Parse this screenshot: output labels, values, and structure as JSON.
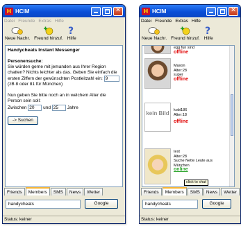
{
  "left_window": {
    "title": "HCIM",
    "menu": [
      "Datei",
      "Freunde",
      "Extras",
      "Hilfe"
    ],
    "toolbar": [
      "Neue Nachr.",
      "Freund hinzuf.",
      "Hilfe"
    ],
    "heading": "Handycheats Instant Messenger",
    "section": "Personensuche:",
    "intro": "Sie würden gerne mit jemanden aus Ihrer Region chatten? Nichts leichter als das. Geben Sie einfach die ersten Ziffern der gewünschten Postleitzahl ein:",
    "zip_value": "9",
    "zip_hint": "(zB 8 oder 81 für München)",
    "age_text": "Nun geben Sie bitte noch an in welchem Alter die Person sein soll:",
    "between": "Zwischen",
    "age_min": "20",
    "and": "und",
    "age_max": "25",
    "years": "Jahre",
    "search_button": "-> Suchen",
    "tabs": [
      "Friends",
      "Members",
      "SMS",
      "News",
      "Wetter"
    ],
    "bottom_input": "handycheats",
    "google_button": "Google",
    "status": "Status: keiner"
  },
  "right_window": {
    "title": "HCIM",
    "menu": [
      "Datei",
      "Freunde",
      "Extras",
      "Hilfe"
    ],
    "toolbar": [
      "Neue Nachr.",
      "Freund hinzuf.",
      "Hilfe"
    ],
    "users": [
      {
        "line1": "egg fun sind",
        "status": "offline"
      },
      {
        "name": "Maxon",
        "age": "Alter:28",
        "desc": "super",
        "status": "offline"
      },
      {
        "name": "kobi186",
        "age": "Alter:18",
        "nopic": "kein Bild",
        "status": "offline"
      },
      {
        "name": "test",
        "age": "Alter:28",
        "desc": "Suche Nette Leute aus München",
        "status": "online"
      }
    ],
    "tooltip": "click to chat",
    "tabs": [
      "Friends",
      "Members",
      "SMS",
      "News",
      "Wetter"
    ],
    "bottom_input": "handycheats",
    "google_button": "Google",
    "status": "Status: keiner"
  }
}
